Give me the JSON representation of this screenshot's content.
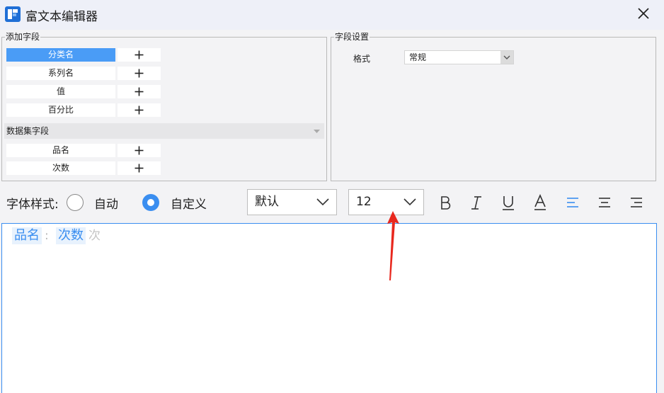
{
  "window": {
    "title": "富文本编辑器"
  },
  "add_field_panel": {
    "legend": "添加字段",
    "fields": [
      {
        "label": "分类名",
        "selected": true
      },
      {
        "label": "系列名",
        "selected": false
      },
      {
        "label": "值",
        "selected": false
      },
      {
        "label": "百分比",
        "selected": false
      }
    ],
    "dataset_section": {
      "label": "数据集字段",
      "fields": [
        {
          "label": "品名"
        },
        {
          "label": "次数"
        }
      ]
    }
  },
  "field_settings_panel": {
    "legend": "字段设置",
    "format_label": "格式",
    "format_value": "常规"
  },
  "toolbar": {
    "font_style_label": "字体样式:",
    "radio_auto": {
      "label": "自动",
      "checked": false
    },
    "radio_custom": {
      "label": "自定义",
      "checked": true
    },
    "font_family": "默认",
    "font_size": "12",
    "buttons": [
      {
        "name": "bold-button",
        "icon": "bold-icon"
      },
      {
        "name": "italic-button",
        "icon": "italic-icon"
      },
      {
        "name": "underline-button",
        "icon": "underline-icon"
      },
      {
        "name": "font-color-button",
        "icon": "font-color-icon"
      },
      {
        "name": "align-left-button",
        "icon": "align-left-icon",
        "active": true
      },
      {
        "name": "align-center-button",
        "icon": "align-center-icon"
      },
      {
        "name": "align-right-button",
        "icon": "align-right-icon"
      }
    ]
  },
  "editor": {
    "tokens": [
      {
        "type": "chip",
        "text": "品名"
      },
      {
        "type": "sep",
        "text": ":"
      },
      {
        "type": "chip",
        "text": "次数"
      },
      {
        "type": "ghost",
        "text": "次"
      }
    ]
  },
  "colors": {
    "accent": "#3a8ef0",
    "selected": "#4a9cf6",
    "annotation_arrow": "#e8281e"
  }
}
